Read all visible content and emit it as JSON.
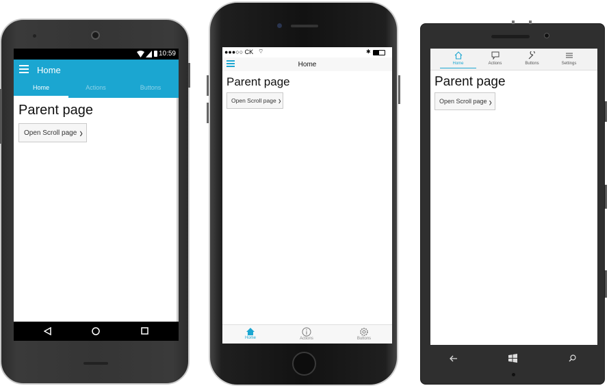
{
  "android": {
    "status": {
      "time": "10:59"
    },
    "toolbar": {
      "title": "Home"
    },
    "tabs": [
      {
        "label": "Home",
        "active": true
      },
      {
        "label": "Actions",
        "active": false
      },
      {
        "label": "Buttons",
        "active": false
      }
    ],
    "content": {
      "title": "Parent page",
      "button_label": "Open Scroll page"
    }
  },
  "iphone": {
    "status": {
      "carrier": "●●●○○ CK"
    },
    "nav": {
      "title": "Home"
    },
    "content": {
      "title": "Parent page",
      "button_label": "Open Scroll page"
    },
    "tabs": [
      {
        "label": "Home",
        "icon": "home-icon",
        "active": true
      },
      {
        "label": "Actions",
        "icon": "info-icon",
        "active": false
      },
      {
        "label": "Buttons",
        "icon": "gear-icon",
        "active": false
      }
    ]
  },
  "windows": {
    "tabs": [
      {
        "label": "Home",
        "icon": "home-icon",
        "active": true
      },
      {
        "label": "Actions",
        "icon": "comment-icon",
        "active": false
      },
      {
        "label": "Buttons",
        "icon": "wrench-icon",
        "active": false
      },
      {
        "label": "Settings",
        "icon": "settings-lines-icon",
        "active": false
      }
    ],
    "content": {
      "title": "Parent page",
      "button_label": "Open Scroll page"
    }
  },
  "colors": {
    "accent": "#1ba6d1"
  }
}
